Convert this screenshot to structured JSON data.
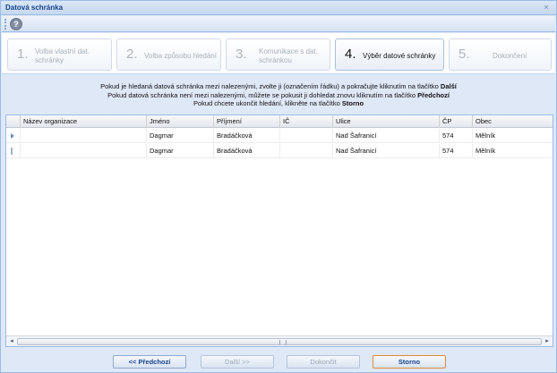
{
  "window": {
    "title": "Datová schránka",
    "close_glyph": "×"
  },
  "toolbar": {
    "help_glyph": "?"
  },
  "steps": [
    {
      "num": "1.",
      "label": "Volba vlastní dat. schránky",
      "active": false
    },
    {
      "num": "2.",
      "label": "Volba způsobu hledání",
      "active": false
    },
    {
      "num": "3.",
      "label": "Komunikace s dat. schránkou",
      "active": false
    },
    {
      "num": "4.",
      "label": "Výběr datové schránky",
      "active": true
    },
    {
      "num": "5.",
      "label": "Dokončení",
      "active": false
    }
  ],
  "instructions": {
    "line1": "Pokud je hledaná datová schránka mezi nalezenými, zvolte ji (označením řádku) a pokračujte kliknutím na tlačítko",
    "line1_bold": "Další",
    "line2": "Pokud datová schránka není mezi nalezenými, můžete se pokusit ji dohledat znovu kliknutím na tlačítko",
    "line2_bold": "Předchozí",
    "line3": "Pokud chcete ukončit hledání, klikněte na tlačítko",
    "line3_bold": "Storno"
  },
  "grid": {
    "columns": [
      "Název organizace",
      "Jméno",
      "Příjmení",
      "IČ",
      "Ulice",
      "ČP",
      "Obec"
    ],
    "rows": [
      [
        "",
        "Dagmar",
        "Bradáčková",
        "",
        "Nad Šafranicí",
        "574",
        "Mělník"
      ],
      [
        "",
        "Dagmar",
        "Bradáčková",
        "",
        "Nad Šafranicí",
        "574",
        "Mělník"
      ]
    ]
  },
  "scroll": {
    "left_glyph": "◂",
    "right_glyph": "▸"
  },
  "footer": {
    "prev_label": "<< Předchozí",
    "next_label": "Další >>",
    "finish_label": "Dokončit",
    "cancel_label": "Storno"
  },
  "colors": {
    "accent": "#15428b",
    "border": "#99bbe8",
    "focus": "#e08a3c"
  }
}
